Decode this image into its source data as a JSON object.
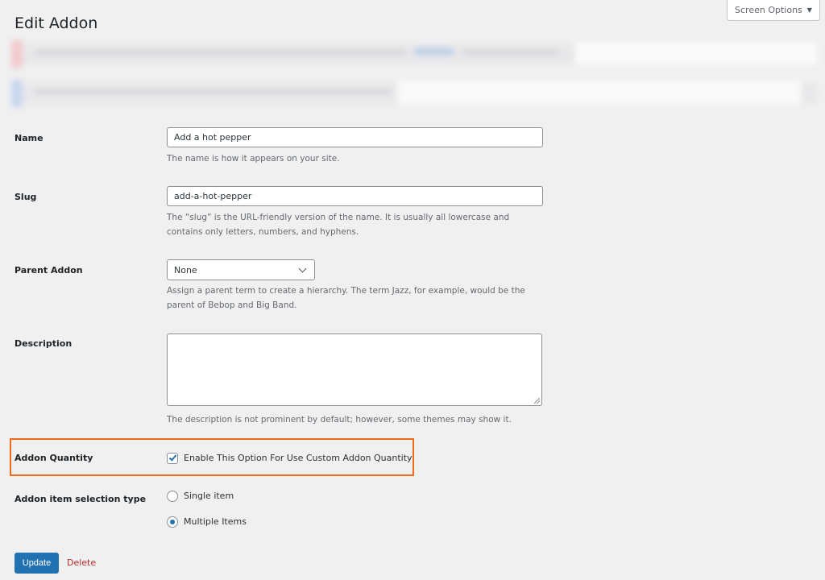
{
  "screen_options": {
    "label": "Screen Options",
    "arrow": "▼"
  },
  "page_title": "Edit Addon",
  "fields": {
    "name": {
      "label": "Name",
      "value": "Add a hot pepper",
      "help": "The name is how it appears on your site."
    },
    "slug": {
      "label": "Slug",
      "value": "add-a-hot-pepper",
      "help_line1": "The “slug” is the URL-friendly version of the name. It is usually all lowercase and",
      "help_line2": "contains only letters, numbers, and hyphens."
    },
    "parent": {
      "label": "Parent Addon",
      "selected": "None",
      "help_line1": "Assign a parent term to create a hierarchy. The term Jazz, for example, would be the",
      "help_line2": "parent of Bebop and Big Band."
    },
    "description": {
      "label": "Description",
      "value": "",
      "help": "The description is not prominent by default; however, some themes may show it."
    },
    "addon_quantity": {
      "label": "Addon Quantity",
      "checkbox_label": "Enable This Option For Use Custom Addon Quantity",
      "checked": true
    },
    "selection_type": {
      "label": "Addon item selection type",
      "options": [
        {
          "label": "Single item",
          "selected": false
        },
        {
          "label": "Multiple Items",
          "selected": true
        }
      ]
    }
  },
  "actions": {
    "update": "Update",
    "delete": "Delete"
  },
  "colors": {
    "primary": "#2271b1",
    "highlight": "#f06a1a",
    "delete": "#b32d2e"
  }
}
